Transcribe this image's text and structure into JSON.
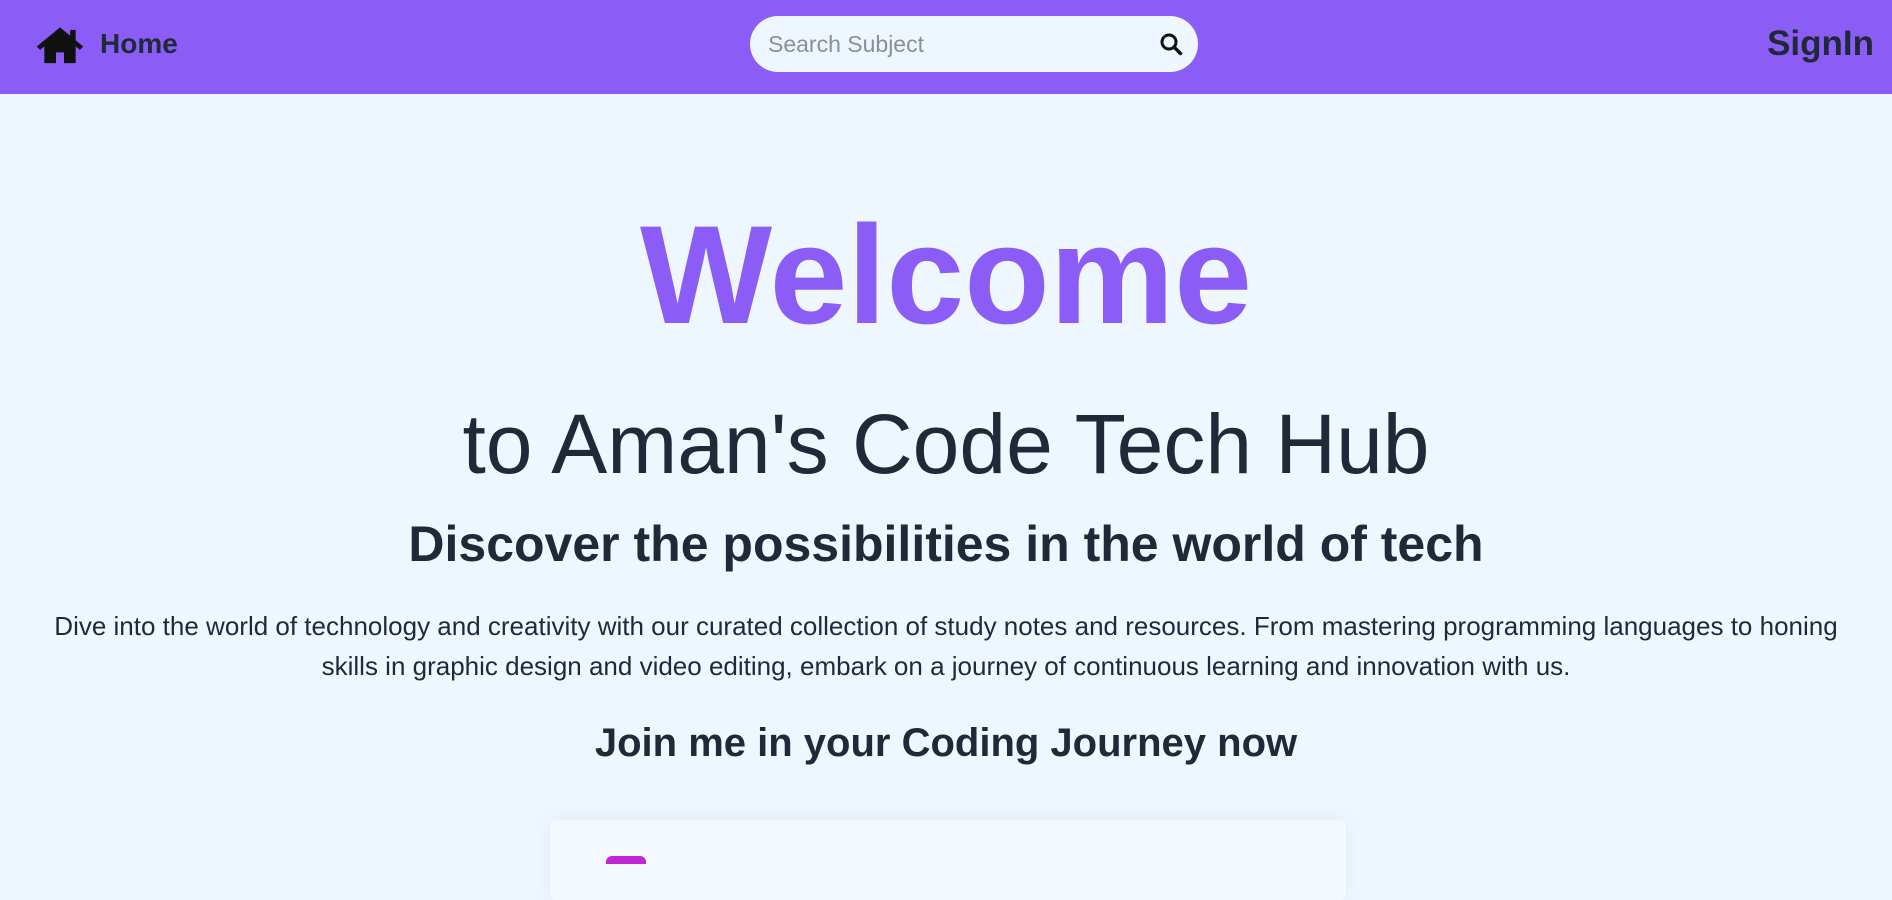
{
  "nav": {
    "home_label": "Home",
    "search_placeholder": "Search Subject",
    "signin_label": "SignIn"
  },
  "hero": {
    "welcome": "Welcome",
    "subtitle": "to Aman's Code Tech Hub",
    "tagline": "Discover the possibilities in the world of tech",
    "description": "Dive into the world of technology and creativity with our curated collection of study notes and resources. From mastering programming languages to honing skills in graphic design and video editing, embark on a journey of continuous learning and innovation with us.",
    "cta_heading": "Join me in your Coding Journey now"
  },
  "colors": {
    "brand": "#8b5cf6",
    "background": "#eef7ff",
    "text": "#1f2937"
  },
  "icons": {
    "home": "home-icon",
    "search": "search-icon"
  }
}
